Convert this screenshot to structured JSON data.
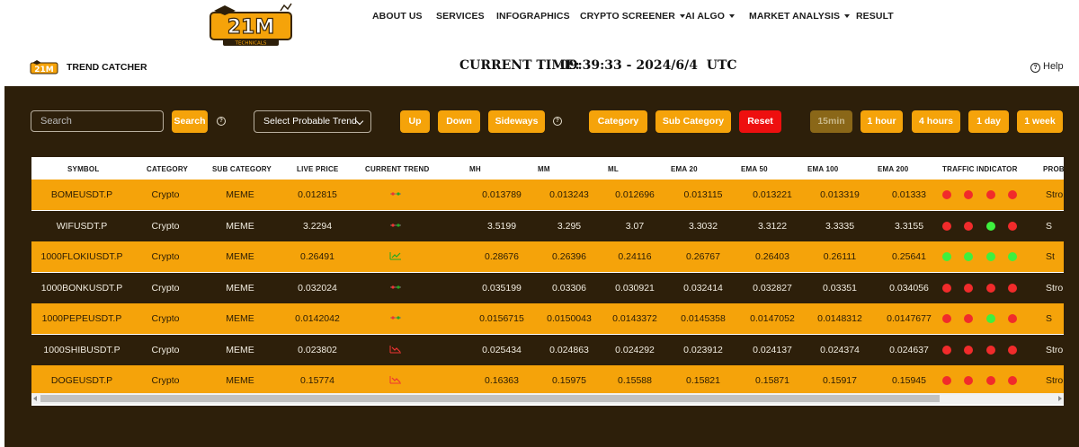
{
  "brand": {
    "logo_text": "21M",
    "logo_subtext": "TECHNICALS"
  },
  "nav": {
    "items": [
      {
        "label": "ABOUT US",
        "dropdown": false
      },
      {
        "label": "SERVICES",
        "dropdown": false
      },
      {
        "label": "INFOGRAPHICS",
        "dropdown": false
      },
      {
        "label": "CRYPTO SCREENER",
        "dropdown": true
      },
      {
        "label": "AI ALGO",
        "dropdown": true
      },
      {
        "label": "MARKET ANALYSIS",
        "dropdown": true
      },
      {
        "label": "RESULT",
        "dropdown": false
      }
    ]
  },
  "header": {
    "page_title": "TREND CATCHER",
    "current_time_label": "CURRENT TIME:",
    "current_time_value": "09:39:33 - 2024/6/4  UTC",
    "help_label": "Help"
  },
  "toolbar": {
    "search_placeholder": "Search",
    "search_button": "Search",
    "probable_trend_select": "Select Probable Trend",
    "trend_buttons": [
      "Up",
      "Down",
      "Sideways"
    ],
    "category_button": "Category",
    "subcategory_button": "Sub Category",
    "reset_button": "Reset",
    "timeframes": [
      "15min",
      "1 hour",
      "4 hours",
      "1 day",
      "1 week"
    ],
    "active_timeframe": "15min"
  },
  "table": {
    "columns": [
      "SYMBOL",
      "CATEGORY",
      "SUB CATEGORY",
      "LIVE PRICE",
      "CURRENT TREND",
      "MH",
      "MM",
      "ML",
      "EMA 20",
      "EMA 50",
      "EMA 100",
      "EMA 200",
      "TRAFFIC INDICATOR",
      "PROB"
    ],
    "rows": [
      {
        "symbol": "BOMEUSDT.P",
        "category": "Crypto",
        "subcategory": "MEME",
        "live_price": "0.012815",
        "trend": "sideways",
        "mh": "0.013789",
        "mm": "0.013243",
        "ml": "0.012696",
        "ema20": "0.013115",
        "ema50": "0.013221",
        "ema100": "0.013319",
        "ema200": "0.01333",
        "traffic": [
          "red",
          "red",
          "red",
          "red"
        ],
        "prob": "Stro"
      },
      {
        "symbol": "WIFUSDT.P",
        "category": "Crypto",
        "subcategory": "MEME",
        "live_price": "3.2294",
        "trend": "sideways",
        "mh": "3.5199",
        "mm": "3.295",
        "ml": "3.07",
        "ema20": "3.3032",
        "ema50": "3.3122",
        "ema100": "3.3335",
        "ema200": "3.3155",
        "traffic": [
          "red",
          "red",
          "green",
          "red"
        ],
        "prob": "S"
      },
      {
        "symbol": "1000FLOKIUSDT.P",
        "category": "Crypto",
        "subcategory": "MEME",
        "live_price": "0.26491",
        "trend": "up",
        "mh": "0.28676",
        "mm": "0.26396",
        "ml": "0.24116",
        "ema20": "0.26767",
        "ema50": "0.26403",
        "ema100": "0.26111",
        "ema200": "0.25641",
        "traffic": [
          "green",
          "green",
          "green",
          "green"
        ],
        "prob": "St"
      },
      {
        "symbol": "1000BONKUSDT.P",
        "category": "Crypto",
        "subcategory": "MEME",
        "live_price": "0.032024",
        "trend": "sideways",
        "mh": "0.035199",
        "mm": "0.03306",
        "ml": "0.030921",
        "ema20": "0.032414",
        "ema50": "0.032827",
        "ema100": "0.03351",
        "ema200": "0.034056",
        "traffic": [
          "red",
          "red",
          "red",
          "red"
        ],
        "prob": "Stro"
      },
      {
        "symbol": "1000PEPEUSDT.P",
        "category": "Crypto",
        "subcategory": "MEME",
        "live_price": "0.0142042",
        "trend": "sideways",
        "mh": "0.0156715",
        "mm": "0.0150043",
        "ml": "0.0143372",
        "ema20": "0.0145358",
        "ema50": "0.0147052",
        "ema100": "0.0148312",
        "ema200": "0.0147677",
        "traffic": [
          "red",
          "red",
          "green",
          "red"
        ],
        "prob": "S"
      },
      {
        "symbol": "1000SHIBUSDT.P",
        "category": "Crypto",
        "subcategory": "MEME",
        "live_price": "0.023802",
        "trend": "down",
        "mh": "0.025434",
        "mm": "0.024863",
        "ml": "0.024292",
        "ema20": "0.023912",
        "ema50": "0.024137",
        "ema100": "0.024374",
        "ema200": "0.024637",
        "traffic": [
          "red",
          "red",
          "red",
          "red"
        ],
        "prob": "Stro"
      },
      {
        "symbol": "DOGEUSDT.P",
        "category": "Crypto",
        "subcategory": "MEME",
        "live_price": "0.15774",
        "trend": "down",
        "mh": "0.16363",
        "mm": "0.15975",
        "ml": "0.15588",
        "ema20": "0.15821",
        "ema50": "0.15871",
        "ema100": "0.15917",
        "ema200": "0.15945",
        "traffic": [
          "red",
          "red",
          "red",
          "red"
        ],
        "prob": "Stro"
      }
    ]
  },
  "colors": {
    "accent": "#f5a30a",
    "dark": "#2d1f0a",
    "reset": "#ee0f0f",
    "red_dot": "#f12b2b",
    "green_dot": "#3ef03e"
  }
}
